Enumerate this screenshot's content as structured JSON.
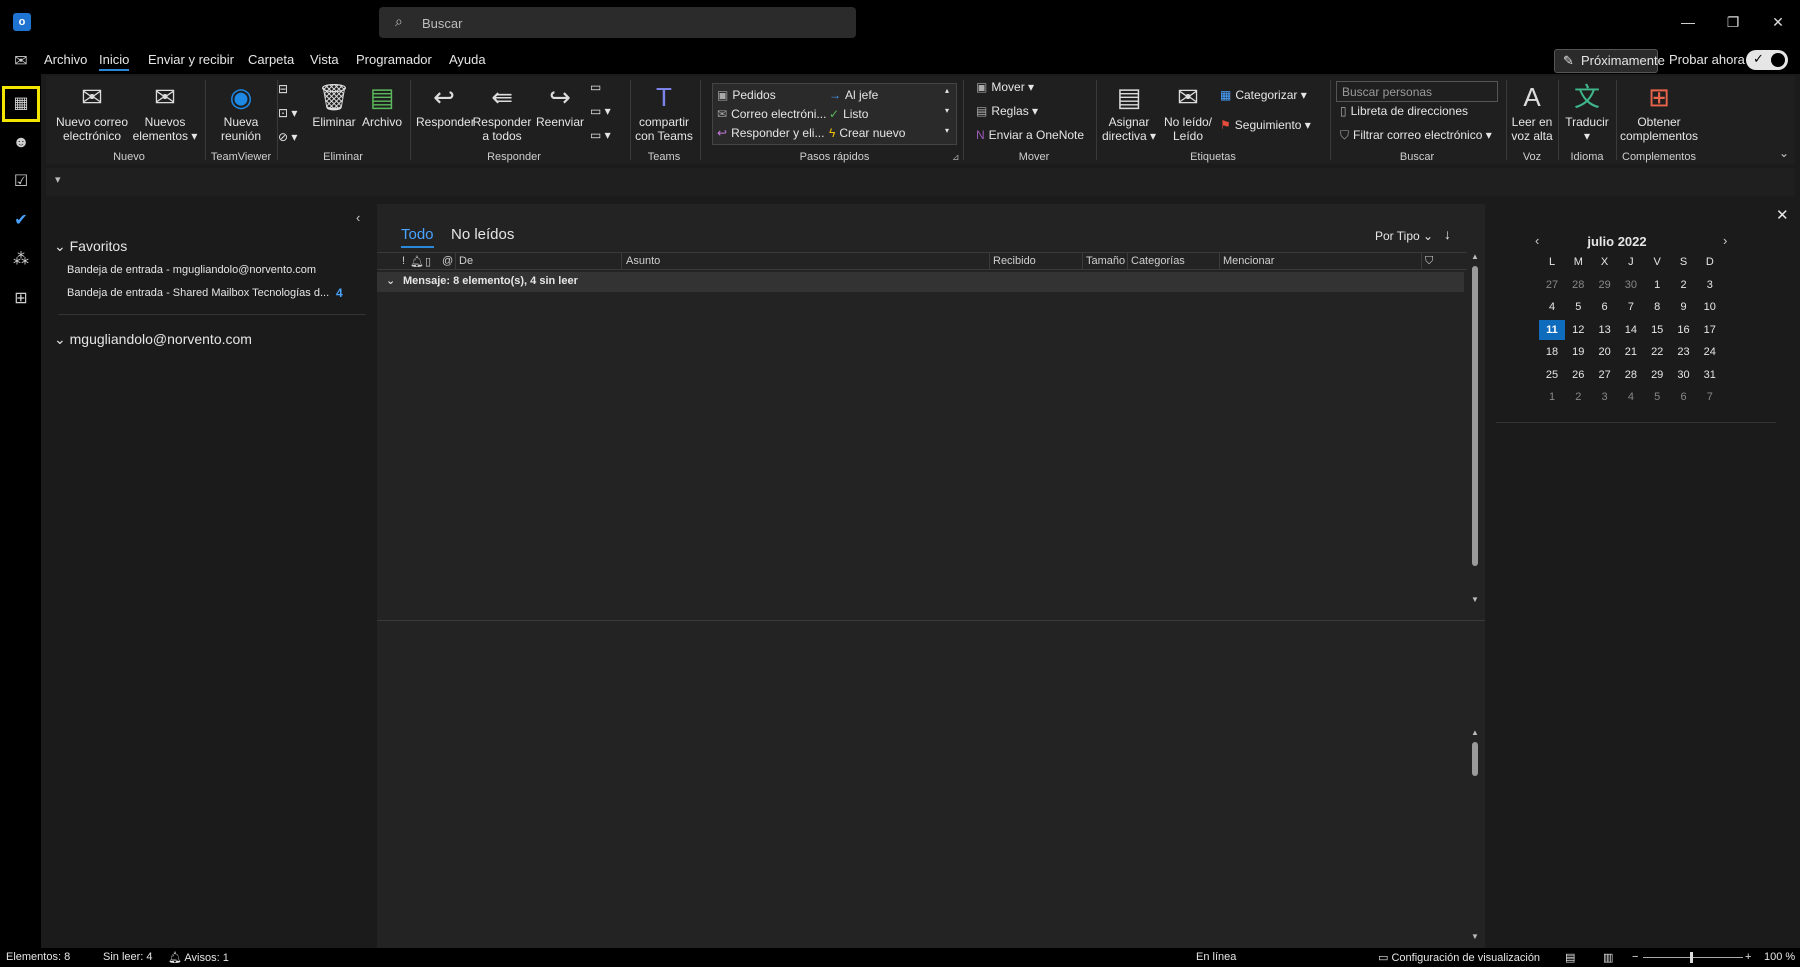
{
  "titlebar": {
    "search_placeholder": "Buscar",
    "minimize": "—",
    "restore": "❐",
    "close": "✕"
  },
  "menu": {
    "items": [
      "Archivo",
      "Inicio",
      "Enviar y recibir",
      "Carpeta",
      "Vista",
      "Programador",
      "Ayuda"
    ],
    "proximamente": "Próximamente",
    "probar_ahora": "Probar ahora"
  },
  "ribbon": {
    "nuevo_correo": [
      "Nuevo correo",
      "electrónico"
    ],
    "nuevos_elementos": [
      "Nuevos",
      "elementos ▾"
    ],
    "nueva_reunion": [
      "Nueva",
      "reunión"
    ],
    "eliminar": "Eliminar",
    "archivo": "Archivo",
    "responder": "Responder",
    "responder_todos": [
      "Responder",
      "a todos"
    ],
    "reenviar": "Reenviar",
    "compartir_teams": [
      "compartir",
      "con Teams"
    ],
    "quicksteps": [
      "Pedidos",
      "Al jefe",
      "Correo electróni...",
      "Listo",
      "Responder y eli...",
      "Crear nuevo"
    ],
    "mover": "Mover ▾",
    "reglas": "Reglas ▾",
    "onenote": "Enviar a OneNote",
    "asignar_directiva": [
      "Asignar",
      "directiva ▾"
    ],
    "no_leido": [
      "No leído/",
      "Leído"
    ],
    "categorizar": "Categorizar ▾",
    "seguimiento": "Seguimiento ▾",
    "buscar_personas": "Buscar personas",
    "libreta": "Libreta de direcciones",
    "filtrar": "Filtrar correo electrónico ▾",
    "leer_voz": [
      "Leer en",
      "voz alta"
    ],
    "traducir": [
      "Traducir",
      "▾"
    ],
    "obtener_complementos": [
      "Obtener",
      "complementos"
    ],
    "groups": [
      "Nuevo",
      "TeamViewer",
      "Eliminar",
      "Responder",
      "Teams",
      "Pasos rápidos",
      "Mover",
      "Etiquetas",
      "Buscar",
      "Voz",
      "Idioma",
      "Complementos"
    ]
  },
  "folders": {
    "favoritos": "Favoritos",
    "inbox1": "Bandeja de entrada - mgugliandolo@norvento.com",
    "inbox2": "Bandeja de entrada - Shared Mailbox Tecnologías d...",
    "inbox2_count": "4",
    "account": "mgugliandolo@norvento.com"
  },
  "messages": {
    "tab_all": "Todo",
    "tab_unread": "No leídos",
    "sort_label": "Por Tipo",
    "sort_arrow": "↓",
    "columns": [
      "!",
      "De",
      "Asunto",
      "Recibido",
      "Tamaño",
      "Categorías",
      "Mencionar"
    ],
    "group_header": "Mensaje: 8 elemento(s), 4 sin leer"
  },
  "calendar": {
    "month_title": "julio 2022",
    "weekdays": [
      "L",
      "M",
      "X",
      "J",
      "V",
      "S",
      "D"
    ],
    "weeks": [
      [
        "27",
        "28",
        "29",
        "30",
        "1",
        "2",
        "3"
      ],
      [
        "4",
        "5",
        "6",
        "7",
        "8",
        "9",
        "10"
      ],
      [
        "11",
        "12",
        "13",
        "14",
        "15",
        "16",
        "17"
      ],
      [
        "18",
        "19",
        "20",
        "21",
        "22",
        "23",
        "24"
      ],
      [
        "25",
        "26",
        "27",
        "28",
        "29",
        "30",
        "31"
      ],
      [
        "1",
        "2",
        "3",
        "4",
        "5",
        "6",
        "7"
      ]
    ],
    "today": "11"
  },
  "status": {
    "elementos": "Elementos: 8",
    "sin_leer": "Sin leer: 4",
    "avisos": "Avisos: 1",
    "en_linea": "En línea",
    "config": "Configuración de visualización",
    "zoom": "100 %"
  },
  "colors": {
    "accent": "#2b88d8",
    "today": "#0f6cbd",
    "highlight": "#f2e600"
  }
}
